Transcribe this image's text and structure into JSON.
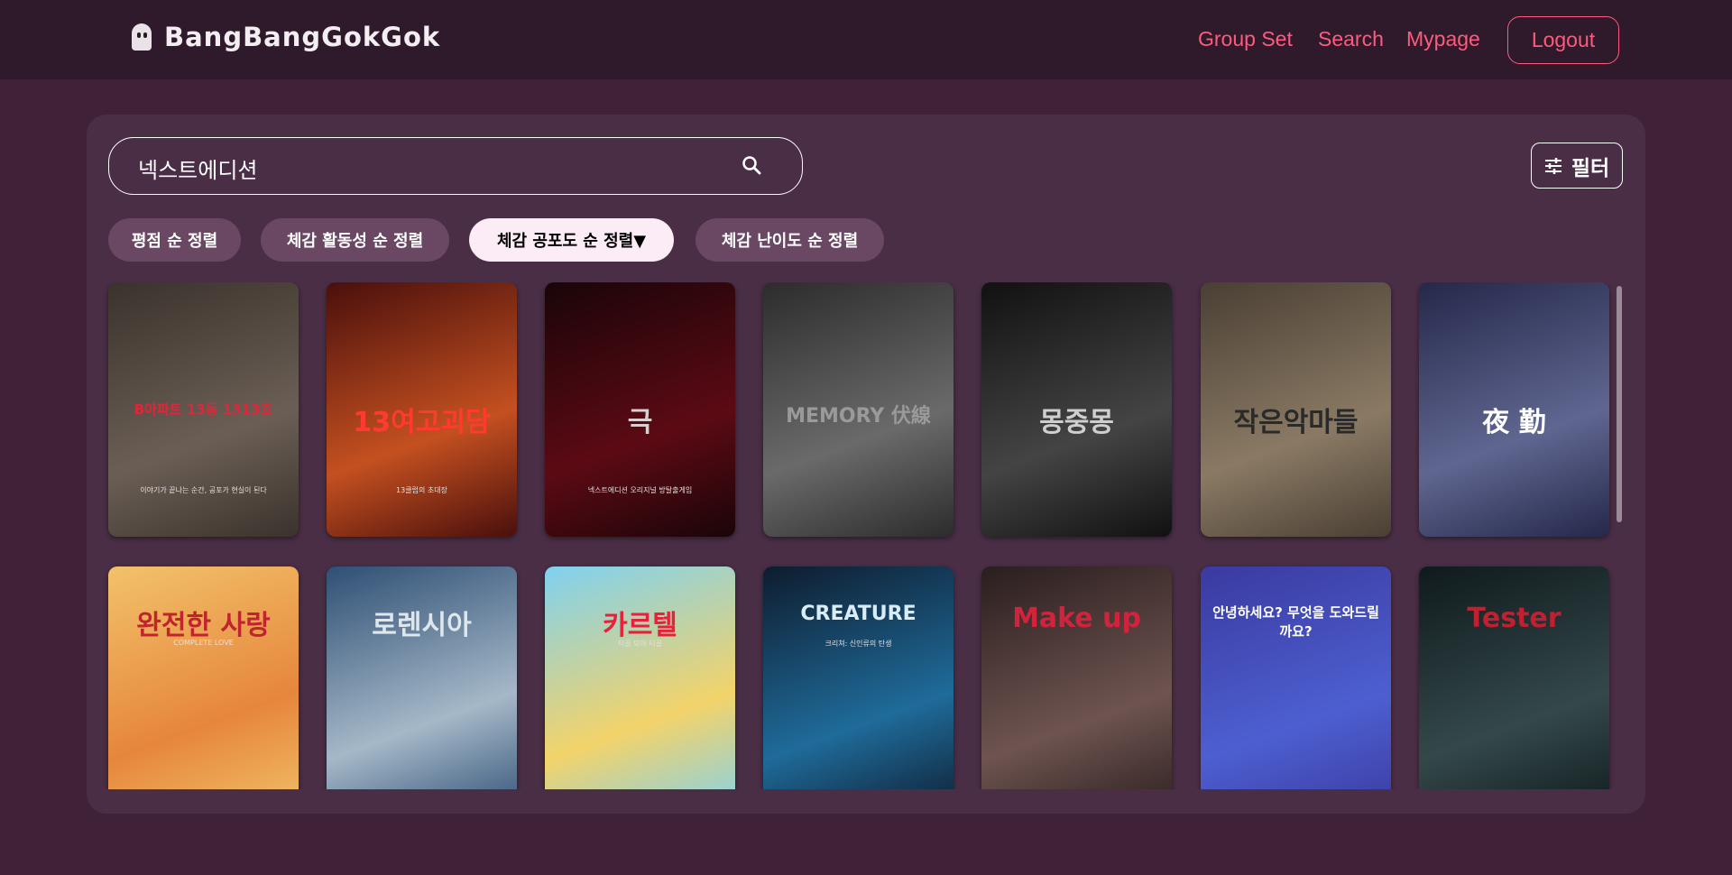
{
  "app": {
    "logo_text": "BangBangGokGok"
  },
  "nav": {
    "group_set": "Group Set",
    "search": "Search",
    "mypage": "Mypage",
    "logout": "Logout"
  },
  "search": {
    "value": "넥스트에디션"
  },
  "filter": {
    "label": "필터"
  },
  "sort": [
    {
      "label": "평점 순 정렬",
      "active": false
    },
    {
      "label": "체감 활동성 순 정렬",
      "active": false
    },
    {
      "label": "체감 공포도 순 정렬▼",
      "active": true
    },
    {
      "label": "체감 난이도 순 정렬",
      "active": false
    }
  ],
  "posters": [
    {
      "title": "B아파트 13동 1313호",
      "subtitle": "이야기가 끝나는 순간, 공포가 현실이 된다",
      "colors": [
        "#3a322c",
        "#6b5f55"
      ],
      "title_color": "#e0263a"
    },
    {
      "title": "13여고괴담",
      "subtitle": "13클럽의 초대장",
      "colors": [
        "#4a0f0c",
        "#c45020"
      ],
      "title_color": "#ff3a2e"
    },
    {
      "title": "극",
      "subtitle": "넥스트에디션 오리지널 방탈출게임",
      "colors": [
        "#1a0508",
        "#5c0a14"
      ],
      "title_color": "#d8d0d0"
    },
    {
      "title": "MEMORY 伏線",
      "subtitle": "",
      "colors": [
        "#2c2c2c",
        "#6a6a6a"
      ],
      "title_color": "#9a9a9a"
    },
    {
      "title": "몽중몽",
      "subtitle": "",
      "colors": [
        "#111111",
        "#444444"
      ],
      "title_color": "#cfcfcf"
    },
    {
      "title": "작은악마들",
      "subtitle": "",
      "colors": [
        "#4a3f34",
        "#8a7a64"
      ],
      "title_color": "#2a2a2a"
    },
    {
      "title": "夜 勤",
      "subtitle": "",
      "colors": [
        "#25284a",
        "#5f6690"
      ],
      "title_color": "#ffffff"
    },
    {
      "title": "완전한 사랑",
      "subtitle": "COMPLETE LOVE",
      "colors": [
        "#f2c26a",
        "#e6863c"
      ],
      "title_color": "#c0242e"
    },
    {
      "title": "로렌시아",
      "subtitle": "",
      "colors": [
        "#2e4f74",
        "#a5b8c8"
      ],
      "title_color": "#dfe7ee"
    },
    {
      "title": "카르텔",
      "subtitle": "티끌 모아 티끌",
      "colors": [
        "#7fd1f0",
        "#f3d36a"
      ],
      "title_color": "#e8203a"
    },
    {
      "title": "CREATURE",
      "subtitle": "크리쳐: 신인류의 탄생",
      "colors": [
        "#0e1c2e",
        "#1f6b9a"
      ],
      "title_color": "#d9ecf7"
    },
    {
      "title": "Make up",
      "subtitle": "",
      "colors": [
        "#2a1e1e",
        "#6e5450"
      ],
      "title_color": "#d2233c"
    },
    {
      "title": "안녕하세요? 무엇을 도와드릴까요?",
      "subtitle": "",
      "colors": [
        "#3a3aa0",
        "#4d5fd0"
      ],
      "title_color": "#ffffff"
    },
    {
      "title": "Tester",
      "subtitle": "",
      "colors": [
        "#0f1a1c",
        "#34484a"
      ],
      "title_color": "#c02030"
    }
  ]
}
